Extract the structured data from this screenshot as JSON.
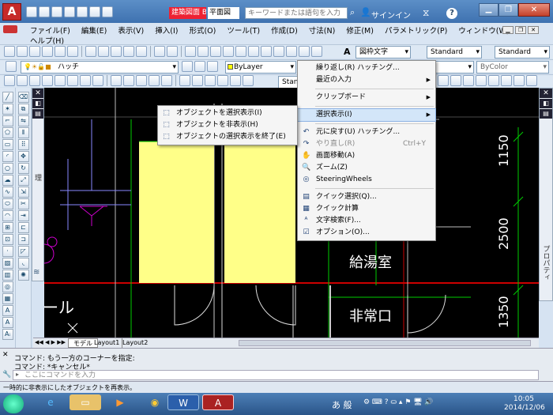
{
  "title_bar": {
    "app_combo": "建築図面 B",
    "doc_title": "平面図",
    "search_placeholder": "キーワードまたは語句を入力",
    "signin": "サインイン",
    "help_icon": "?"
  },
  "menu_bar": {
    "items": [
      "ファイル(F)",
      "編集(E)",
      "表示(V)",
      "挿入(I)",
      "形式(O)",
      "ツール(T)",
      "作成(D)",
      "寸法(N)",
      "修正(M)",
      "パラメトリック(P)",
      "ウィンドウ(W)"
    ],
    "help": "ヘルプ(H)"
  },
  "toolbar": {
    "text_style": "図枠文字",
    "dim_style": "Standard",
    "table_style": "Standard",
    "layer": "ハッチ",
    "color": "ByLayer",
    "linetype_partial": "yer",
    "lineweight": "ByColor",
    "dim_partial": "Stand"
  },
  "drawing": {
    "room_kyuto": "給湯室",
    "room_hijoguchi": "非常口",
    "room_hall": "ホール",
    "dim_1150": "1150",
    "dim_2500": "2500",
    "dim_1350": "1350",
    "tabs": [
      "モデル",
      "Layout1",
      "Layout2"
    ],
    "left_palette_label": "画層プロパティ管理",
    "right_palette_label": "プロパティ"
  },
  "context_menu": {
    "items": [
      {
        "label": "繰り返し(R) ハッチング...",
        "icon": ""
      },
      {
        "label": "最近の入力",
        "icon": "",
        "submenu": true
      },
      {
        "sep": true
      },
      {
        "label": "クリップボード",
        "icon": "",
        "submenu": true
      },
      {
        "sep": true
      },
      {
        "label": "選択表示(I)",
        "icon": "",
        "submenu": true,
        "highlight": true
      },
      {
        "sep": true
      },
      {
        "label": "元に戻す(U) ハッチング...",
        "icon": "↶"
      },
      {
        "label": "やり直し(R)",
        "icon": "↷",
        "shortcut": "Ctrl+Y",
        "disabled": true
      },
      {
        "label": "画面移動(A)",
        "icon": "✋"
      },
      {
        "label": "ズーム(Z)",
        "icon": "🔍"
      },
      {
        "label": "SteeringWheels",
        "icon": "◎"
      },
      {
        "sep": true
      },
      {
        "label": "クイック選択(Q)...",
        "icon": "▤"
      },
      {
        "label": "クイック計算",
        "icon": "▦"
      },
      {
        "label": "文字検索(F)...",
        "icon": "ᴬ"
      },
      {
        "label": "オプション(O)...",
        "icon": "☑"
      }
    ]
  },
  "submenu": {
    "items": [
      {
        "label": "オブジェクトを選択表示(I)",
        "icon": "⬚"
      },
      {
        "label": "オブジェクトを非表示(H)",
        "icon": "⬚"
      },
      {
        "label": "オブジェクトの選択表示を終了(E)",
        "icon": "⬚"
      }
    ]
  },
  "command": {
    "line1": "コマンド: もう一方のコーナーを指定:",
    "line2": "コマンド: *キャンセル*",
    "input_placeholder": "ここにコマンドを入力"
  },
  "status_text": "一時的に非表示にしたオブジェクトを再表示。",
  "taskbar": {
    "time": "10:05",
    "date": "2014/12/06",
    "ime": "あ 般"
  }
}
